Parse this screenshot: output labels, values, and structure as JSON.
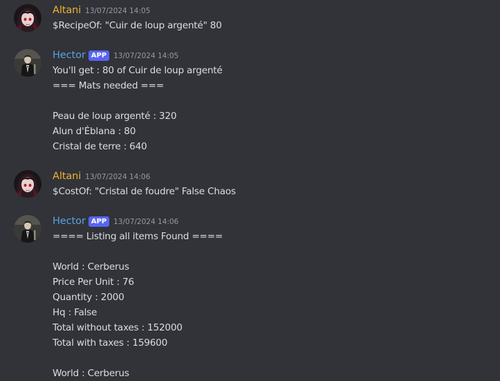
{
  "colors": {
    "background": "#313338",
    "text": "#dbdee1",
    "timestamp": "#949ba4",
    "altani_name": "#f0b232",
    "hector_name": "#5aa2e0",
    "app_badge": "#5865f2"
  },
  "messages": [
    {
      "username": "Altani",
      "is_app": false,
      "timestamp": "13/07/2024 14:05",
      "avatar_icon": "anime-girl-avatar-icon",
      "lines": [
        "$RecipeOf: \"Cuir de loup argenté\" 80"
      ]
    },
    {
      "username": "Hector",
      "is_app": true,
      "badge": "APP",
      "timestamp": "13/07/2024 14:05",
      "avatar_icon": "suited-man-avatar-icon",
      "lines": [
        "You'll get : 80 of Cuir de loup argenté",
        "=== Mats needed ===",
        "",
        "Peau de loup argenté : 320",
        "Alun d'Éblana : 80",
        "Cristal de terre : 640"
      ]
    },
    {
      "username": "Altani",
      "is_app": false,
      "timestamp": "13/07/2024 14:06",
      "avatar_icon": "anime-girl-avatar-icon",
      "lines": [
        "$CostOf: \"Cristal de foudre\" False Chaos"
      ]
    },
    {
      "username": "Hector",
      "is_app": true,
      "badge": "APP",
      "timestamp": "13/07/2024 14:06",
      "avatar_icon": "suited-man-avatar-icon",
      "lines": [
        "==== Listing all items Found ====",
        "",
        "World : Cerberus",
        "Price Per Unit : 76",
        "Quantity : 2000",
        "Hq : False",
        "Total without taxes : 152000",
        "Total with taxes : 159600",
        "",
        "World : Cerberus"
      ]
    }
  ]
}
